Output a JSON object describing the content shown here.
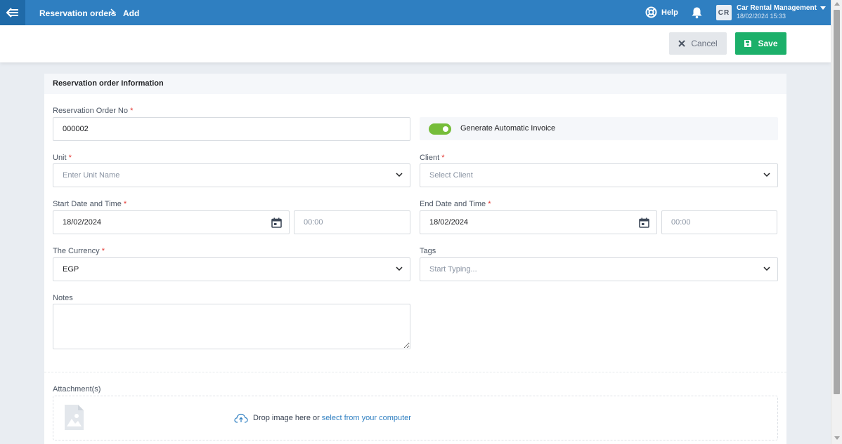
{
  "topbar": {
    "breadcrumb": [
      "Reservation orders",
      "Add"
    ],
    "help_label": "Help",
    "avatar_initials": "CR",
    "account_name": "Car Rental Management",
    "account_datetime": "18/02/2024 15:33",
    "color": "#2f7fc1"
  },
  "actions": {
    "cancel_label": "Cancel",
    "save_label": "Save",
    "save_color": "#1cb06a"
  },
  "form": {
    "section_title": "Reservation order Information",
    "order_no": {
      "label": "Reservation Order No",
      "value": "000002"
    },
    "auto_invoice": {
      "label": "Generate Automatic Invoice",
      "enabled": true,
      "color": "#76bd3a"
    },
    "unit": {
      "label": "Unit",
      "placeholder": "Enter Unit Name"
    },
    "client": {
      "label": "Client",
      "placeholder": "Select Client"
    },
    "start": {
      "label": "Start Date and Time",
      "date": "18/02/2024",
      "time_placeholder": "00:00"
    },
    "end": {
      "label": "End Date and Time",
      "date": "18/02/2024",
      "time_placeholder": "00:00"
    },
    "currency": {
      "label": "The Currency",
      "value": "EGP"
    },
    "tags": {
      "label": "Tags",
      "placeholder": "Start Typing..."
    },
    "notes": {
      "label": "Notes",
      "value": ""
    },
    "attachments": {
      "label": "Attachment(s)",
      "drop_text": "Drop image here or",
      "link_text": "select from your computer"
    },
    "required_mark": "*"
  }
}
